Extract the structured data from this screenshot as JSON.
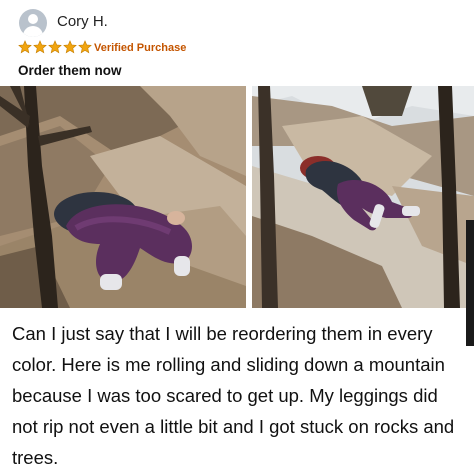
{
  "review": {
    "reviewer_name": "Cory H.",
    "rating": 5,
    "star_color": "#f0a40f",
    "verified_label": "Verified Purchase",
    "verified_color": "#c45500",
    "title": "Order them now",
    "body": "Can I just say that I will be reordering them in every color. Here is me rolling and sliding down a mountain because I was too scared to get up. My leggings did not rip not even a little bit and I got stuck on rocks and trees."
  },
  "icons": {
    "avatar": "default-user-avatar-icon",
    "star": "star-icon"
  },
  "photos": [
    {
      "subject": "person-lying-on-rocks-tree",
      "legging_color": "#5b2f5e"
    },
    {
      "subject": "person-sliding-down-slope",
      "legging_color": "#5b2f5e"
    }
  ]
}
